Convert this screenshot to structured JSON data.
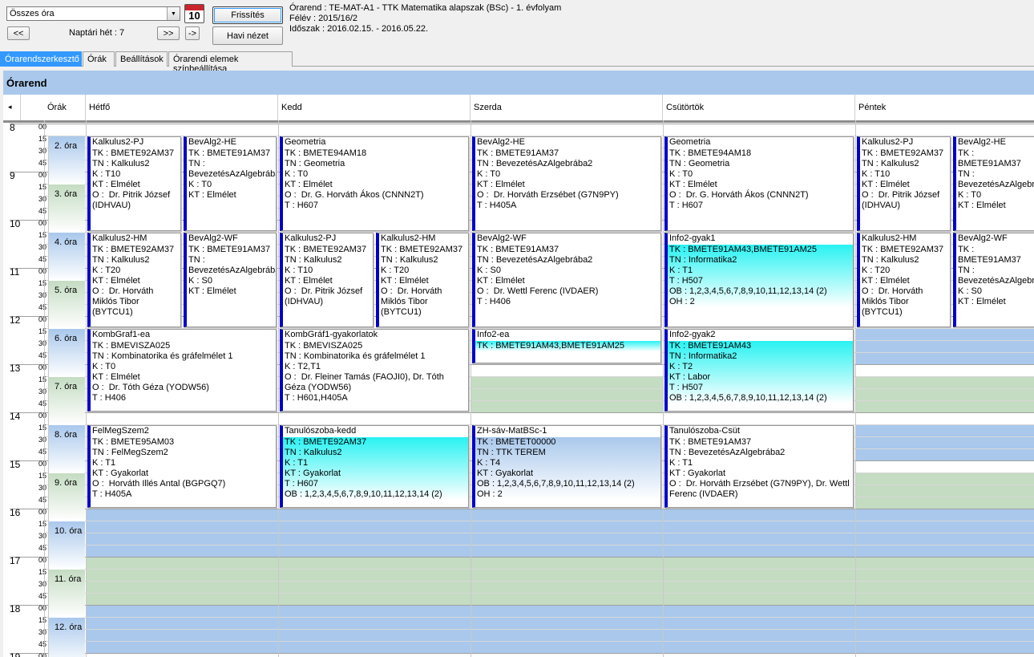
{
  "toolbar": {
    "combo_value": "Összes óra",
    "prev_label": "<<",
    "next_label": ">>",
    "jump_label": "->",
    "week_label": "Naptári hét : 7",
    "calendar_day": "10",
    "refresh_label": "Frissítés",
    "month_view_label": "Havi nézet"
  },
  "info": {
    "line1": "Órarend : TE-MAT-A1 - TTK Matematika alapszak (BSc) - 1. évfolyam",
    "line2": "Félév : 2015/16/2",
    "line3": "Időszak : 2016.02.15. - 2016.05.22."
  },
  "tabs": [
    "Órarendszerkesztő",
    "Órák",
    "Beállítások",
    "Órarendi elemek színbeállítása"
  ],
  "panel_title": "Órarend",
  "grid": {
    "scroll_left_label": "◂",
    "lessons_header": "Órák",
    "days": [
      "Hétfő",
      "Kedd",
      "Szerda",
      "Csütörtök",
      "Péntek"
    ],
    "hours": [
      "8",
      "9",
      "10",
      "11",
      "12",
      "13",
      "14",
      "15",
      "16",
      "17",
      "18",
      "19"
    ],
    "minutes": [
      "00",
      "15",
      "30",
      "45"
    ],
    "lessons": [
      "2. óra",
      "3. óra",
      "4. óra",
      "5. óra",
      "6. óra",
      "7. óra",
      "8. óra",
      "9. óra",
      "10. óra",
      "11. óra",
      "12. óra"
    ]
  },
  "events": [
    {
      "title": "Kalkulus2-PJ",
      "lines": [
        "TK : BMETE92AM37",
        "TN : Kalkulus2",
        "K : T10",
        "KT : Elmélet",
        "O :  Dr. Pitrik József (IDHVAU)"
      ],
      "highlight": 0,
      "style": "plain"
    },
    {
      "title": "BevAlg2-HE",
      "lines": [
        "TK : BMETE91AM37",
        "TN : BevezetésAzAlgebrába2",
        "K : T0",
        "KT : Elmélet"
      ],
      "highlight": 0,
      "style": "plain"
    },
    {
      "title": "Geometria",
      "lines": [
        "TK : BMETE94AM18",
        "TN : Geometria",
        "K : T0",
        "KT : Elmélet",
        "O :  Dr. G. Horváth Ákos (CNNN2T)",
        "T : H607"
      ],
      "highlight": 0,
      "style": "plain"
    },
    {
      "title": "BevAlg2-HE",
      "lines": [
        "TK : BMETE91AM37",
        "TN : BevezetésAzAlgebrába2",
        "K : T0",
        "KT : Elmélet",
        "O :  Dr. Horváth Erzsébet (G7N9PY)",
        "T : H405A"
      ],
      "highlight": 0,
      "style": "plain"
    },
    {
      "title": "Geometria",
      "lines": [
        "TK : BMETE94AM18",
        "TN : Geometria",
        "K : T0",
        "KT : Elmélet",
        "O :  Dr. G. Horváth Ákos (CNNN2T)",
        "T : H607"
      ],
      "highlight": 0,
      "style": "plain"
    },
    {
      "title": "Kalkulus2-PJ",
      "lines": [
        "TK : BMETE92AM37",
        "TN : Kalkulus2",
        "K : T10",
        "KT : Elmélet",
        "O :  Dr. Pitrik József (IDHVAU)"
      ],
      "highlight": 0,
      "style": "plain"
    },
    {
      "title": "BevAlg2-HE",
      "lines": [
        "TK : BMETE91AM37",
        "TN : BevezetésAzAlgebrába2",
        "K : T0",
        "KT : Elmélet"
      ],
      "highlight": 0,
      "style": "plain"
    },
    {
      "title": "Kalkulus2-HM",
      "lines": [
        "TK : BMETE92AM37",
        "TN : Kalkulus2",
        "K : T20",
        "KT : Elmélet",
        "O :  Dr. Horváth Miklós Tibor (BYTCU1)"
      ],
      "highlight": 0,
      "style": "plain"
    },
    {
      "title": "BevAlg2-WF",
      "lines": [
        "TK : BMETE91AM37",
        "TN : BevezetésAzAlgebrába2",
        "K : S0",
        "KT : Elmélet"
      ],
      "highlight": 0,
      "style": "plain"
    },
    {
      "title": "Kalkulus2-PJ",
      "lines": [
        "TK : BMETE92AM37",
        "TN : Kalkulus2",
        "K : T10",
        "KT : Elmélet",
        "O :  Dr. Pitrik József (IDHVAU)"
      ],
      "highlight": 0,
      "style": "plain"
    },
    {
      "title": "Kalkulus2-HM",
      "lines": [
        "TK : BMETE92AM37",
        "TN : Kalkulus2",
        "K : T20",
        "KT : Elmélet",
        "O :  Dr. Horváth Miklós Tibor (BYTCU1)"
      ],
      "highlight": 0,
      "style": "plain"
    },
    {
      "title": "BevAlg2-WF",
      "lines": [
        "TK : BMETE91AM37",
        "TN : BevezetésAzAlgebrába2",
        "K : S0",
        "KT : Elmélet",
        "O :  Dr. Wettl Ferenc (IVDAER)",
        "T : H406"
      ],
      "highlight": 0,
      "style": "plain"
    },
    {
      "title": "Info2-gyak1",
      "lines": [
        "TK : BMETE91AM43,BMETE91AM25",
        "TN : Informatika2",
        "K : T1",
        "T : H507",
        "OB : 1,2,3,4,5,6,7,8,9,10,11,12,13,14 (2)",
        "OH : 2"
      ],
      "highlight": 6,
      "style": "cyan"
    },
    {
      "title": "Kalkulus2-HM",
      "lines": [
        "TK : BMETE92AM37",
        "TN : Kalkulus2",
        "K : T20",
        "KT : Elmélet",
        "O :  Dr. Horváth Miklós Tibor (BYTCU1)"
      ],
      "highlight": 0,
      "style": "plain"
    },
    {
      "title": "BevAlg2-WF",
      "lines": [
        "TK : BMETE91AM37",
        "TN : BevezetésAzAlgebrába2",
        "K : S0",
        "KT : Elmélet"
      ],
      "highlight": 0,
      "style": "plain"
    },
    {
      "title": "KombGraf1-ea",
      "lines": [
        "TK : BMEVISZA025",
        "TN : Kombinatorika és gráfelmélet 1",
        "K : T0",
        "KT : Elmélet",
        "O :  Dr. Tóth Géza (YODW56)",
        "T : H406"
      ],
      "highlight": 0,
      "style": "plain"
    },
    {
      "title": "KombGráf1-gyakorlatok",
      "lines": [
        "TK : BMEVISZA025",
        "TN : Kombinatorika és gráfelmélet 1",
        "K : T2,T1",
        "O :  Dr. Fleiner Tamás (FAOJI0), Dr. Tóth Géza (YODW56)",
        "T : H601,H405A"
      ],
      "highlight": 0,
      "style": "plain"
    },
    {
      "title": "Info2-ea",
      "lines": [
        "TK : BMETE91AM43,BMETE91AM25"
      ],
      "highlight": 1,
      "style": "cyan"
    },
    {
      "title": "Info2-gyak2",
      "lines": [
        "TK : BMETE91AM43",
        "TN : Informatika2",
        "K : T2",
        "KT : Labor",
        "T : H507",
        "OB : 1,2,3,4,5,6,7,8,9,10,11,12,13,14 (2)"
      ],
      "highlight": 6,
      "style": "cyan"
    },
    {
      "title": "FelMegSzem2",
      "lines": [
        "TK : BMETE95AM03",
        "TN : FelMegSzem2",
        "K : T1",
        "KT : Gyakorlat",
        "O :  Horváth Illés Antal (BGPGQ7)",
        "T : H405A"
      ],
      "highlight": 0,
      "style": "plain"
    },
    {
      "title": "Tanulószoba-kedd",
      "lines": [
        "TK : BMETE92AM37",
        "TN : Kalkulus2",
        "K : T1",
        "KT : Gyakorlat",
        "T : H607",
        "OB : 1,2,3,4,5,6,7,8,9,10,11,12,13,14 (2)"
      ],
      "highlight": 6,
      "style": "cyan"
    },
    {
      "title": "ZH-sáv-MatBSc-1",
      "lines": [
        "TK : BMETET00000",
        "TN : TTK TEREM",
        "K : T4",
        "KT : Gyakorlat",
        "OB : 1,2,3,4,5,6,7,8,9,10,11,12,13,14 (2)",
        "OH : 2"
      ],
      "highlight": 6,
      "style": "blue"
    },
    {
      "title": "Tanulószoba-Csüt",
      "lines": [
        "TK : BMETE91AM37",
        "TN : BevezetésAzAlgebrába2",
        "K : T1",
        "KT : Gyakorlat",
        "O :  Dr. Horváth Erzsébet (G7N9PY), Dr. Wettl Ferenc (IVDAER)"
      ],
      "highlight": 0,
      "style": "plain"
    }
  ],
  "colors": {
    "blue_slot": "#a9c8ec",
    "green_slot": "#c4dcc2",
    "event_border": "#0000c8",
    "cyan": "#29f2f2",
    "tab_active": "#3399ff"
  }
}
